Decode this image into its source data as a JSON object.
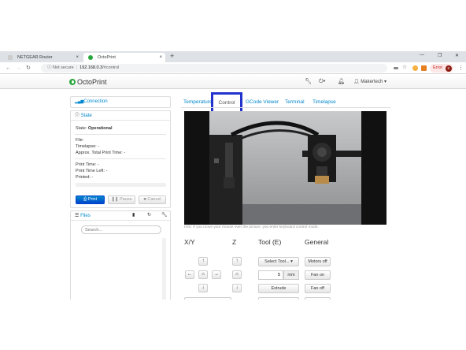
{
  "browser": {
    "tabs": [
      {
        "title": "NETGEAR Router",
        "close": "×"
      },
      {
        "title": "OctoPrint",
        "close": "×"
      }
    ],
    "new_tab": "+",
    "url": {
      "security": "Not secure",
      "host": "192.168.0.3",
      "path": "/#control"
    },
    "error_label": "Error",
    "avatar_letter": "K",
    "window_controls": [
      "—",
      "❐",
      "✕"
    ]
  },
  "octoprint": {
    "brand": "OctoPrint",
    "user": "Makertech",
    "sidebar": {
      "connection": "Connection",
      "state_title": "State",
      "state_label": "State:",
      "state_value": "Operational",
      "file": "File:",
      "timelapse": "Timelapse: -",
      "approx": "Approx. Total Print Time: -",
      "print_time": "Print Time: -",
      "print_time_left": "Print Time Left: -",
      "printed": "Printed: -",
      "buttons": {
        "print": "Print",
        "pause": "Pause",
        "cancel": "Cancel"
      },
      "files_title": "Files",
      "search_placeholder": "Search..."
    },
    "tabs": [
      "Temperature",
      "Control",
      "GCode Viewer",
      "Terminal",
      "Timelapse"
    ],
    "active_tab": "Control",
    "webcam_hint": "Hint: If you move your mouse over the picture, you enter keyboard control mode.",
    "control": {
      "xy": "X/Y",
      "z": "Z",
      "tool": "Tool (E)",
      "general": "General",
      "select_tool": "Select Tool...",
      "amount": "5",
      "unit": "mm",
      "extrude": "Extrude",
      "motors_off": "Motors off",
      "fan_on": "Fan on",
      "fan_off": "Fan off"
    },
    "colors": {
      "highlight": "#2233cc",
      "link": "#0088cc",
      "primary": "#0066cc"
    }
  }
}
